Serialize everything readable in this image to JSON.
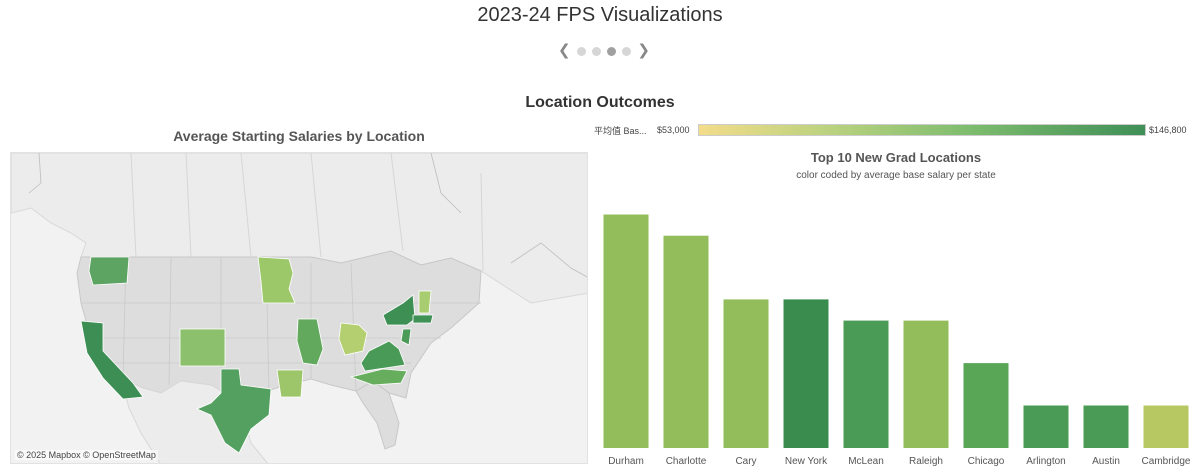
{
  "page": {
    "title": "2023-24 FPS Visualizations",
    "carousel": {
      "dots": 4,
      "active_index": 2
    }
  },
  "section": {
    "title": "Location Outcomes"
  },
  "map": {
    "title": "Average Starting Salaries by Location",
    "attribution": "© 2025 Mapbox  © OpenStreetMap",
    "highlighted_states": [
      {
        "state": "Washington",
        "color": "#5da463"
      },
      {
        "state": "California",
        "color": "#3d8e54"
      },
      {
        "state": "Minnesota",
        "color": "#9cc86a"
      },
      {
        "state": "Colorado",
        "color": "#8cc06d"
      },
      {
        "state": "Texas",
        "color": "#54a060"
      },
      {
        "state": "Illinois",
        "color": "#62a95e"
      },
      {
        "state": "Arkansas",
        "color": "#9dc56a"
      },
      {
        "state": "Ohio",
        "color": "#b3cf6f"
      },
      {
        "state": "Virginia",
        "color": "#489a56"
      },
      {
        "state": "North Carolina",
        "color": "#67ad5e"
      },
      {
        "state": "New York",
        "color": "#3e8f54"
      },
      {
        "state": "New Jersey",
        "color": "#4b9a58"
      },
      {
        "state": "Vermont/NH",
        "color": "#a8cc70"
      },
      {
        "state": "Massachusetts",
        "color": "#3f9156"
      }
    ]
  },
  "legend": {
    "label": "平均值 Bas...",
    "min": "$53,000",
    "max": "$146,800"
  },
  "chart_data": {
    "type": "bar",
    "title": "Top 10 New Grad Locations",
    "subtitle": "color coded by average base salary per state",
    "categories": [
      "Durham",
      "Charlotte",
      "Cary",
      "New York",
      "McLean",
      "Raleigh",
      "Chicago",
      "Arlington",
      "Austin",
      "Cambridge"
    ],
    "values": [
      11,
      10,
      7,
      7,
      6,
      6,
      4,
      2,
      2,
      2
    ],
    "colors": [
      "#93bd5b",
      "#93bd5b",
      "#93bd5b",
      "#3a8c4e",
      "#4a9b55",
      "#93bd5b",
      "#5aa657",
      "#4a9b55",
      "#4a9b55",
      "#b7c863"
    ],
    "ylim": [
      0,
      11.4
    ]
  }
}
